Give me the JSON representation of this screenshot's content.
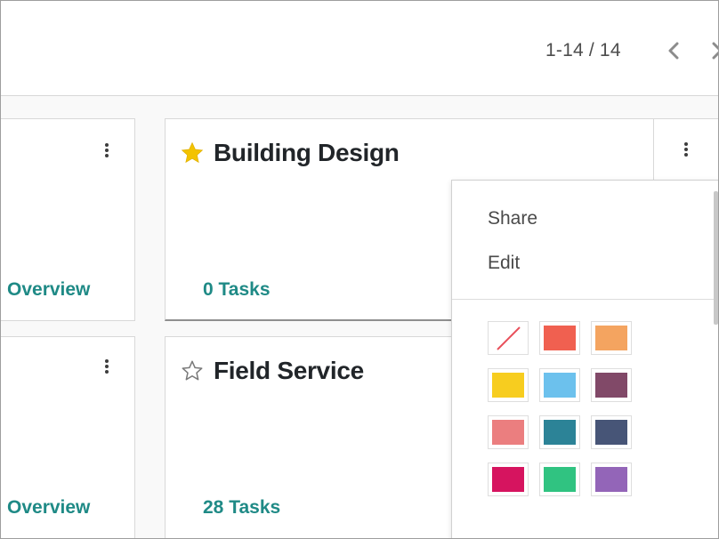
{
  "pager": {
    "value": "1-14 / 14"
  },
  "cards": {
    "left_top": {
      "link_label": "Overview"
    },
    "left_bottom": {
      "link_label": "Overview"
    },
    "building_design": {
      "title": "Building Design",
      "favorite": true,
      "task_count": "0",
      "task_label": "Tasks"
    },
    "field_service": {
      "title": "Field Service",
      "favorite": false,
      "task_count": "28",
      "task_label": "Tasks"
    }
  },
  "dropdown": {
    "items": [
      {
        "label": "Share"
      },
      {
        "label": "Edit"
      }
    ],
    "colors": [
      {
        "name": "no-color",
        "hex": "none"
      },
      {
        "name": "red",
        "hex": "#F06050"
      },
      {
        "name": "orange",
        "hex": "#F4A460"
      },
      {
        "name": "yellow",
        "hex": "#F7CD1F"
      },
      {
        "name": "light-blue",
        "hex": "#6CC1ED"
      },
      {
        "name": "dark-purple",
        "hex": "#814968"
      },
      {
        "name": "salmon-pink",
        "hex": "#EB7E7F"
      },
      {
        "name": "medium-blue",
        "hex": "#2C8397"
      },
      {
        "name": "dark-blue",
        "hex": "#475577"
      },
      {
        "name": "fuchsia",
        "hex": "#D6145F"
      },
      {
        "name": "green",
        "hex": "#30C381"
      },
      {
        "name": "purple",
        "hex": "#9365B8"
      }
    ]
  },
  "theme": {
    "accent": "#1f8a86",
    "star_active": "#f3c300"
  }
}
